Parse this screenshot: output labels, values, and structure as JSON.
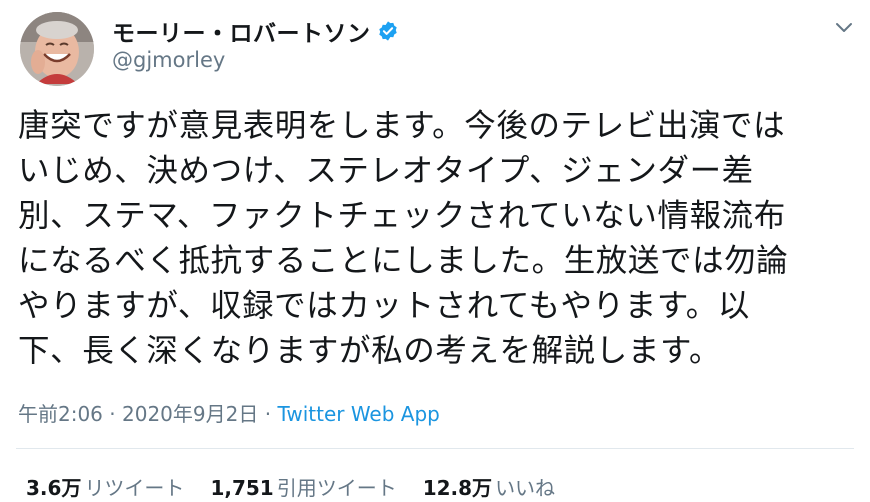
{
  "user": {
    "display_name": "モーリー・ロバートソン",
    "handle": "@gjmorley"
  },
  "tweet": {
    "lines": [
      "唐突ですが意見表明をします。今後のテレビ出演では",
      "いじめ、決めつけ、ステレオタイプ、ジェンダー差",
      "別、ステマ、ファクトチェックされていない情報流布",
      "になるべく抵抗することにしました。生放送では勿論",
      "やりますが、収録ではカットされてもやります。以",
      "下、長く深くなりますが私の考えを解説します。"
    ],
    "time": "午前2:06",
    "separator": "·",
    "date": "2020年9月2日",
    "source": "Twitter Web App"
  },
  "stats": {
    "retweets": {
      "num": "3.6万",
      "label": "リツイート"
    },
    "quotes": {
      "num": "1,751",
      "label": "引用ツイート"
    },
    "likes": {
      "num": "12.8万",
      "label": "いいね"
    }
  },
  "colors": {
    "text": "#14171a",
    "secondary": "#657786",
    "link": "#1b95e0",
    "verified": "#1da1f2",
    "divider": "#e1e8ed"
  },
  "icons": {
    "verified": "verified-badge-icon",
    "more": "chevron-down-icon"
  }
}
